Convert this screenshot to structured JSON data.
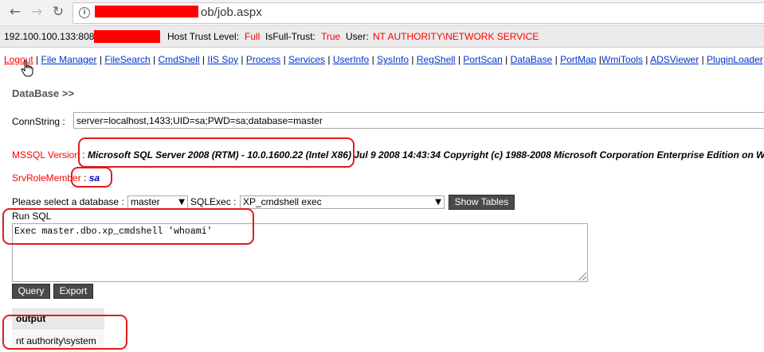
{
  "browser": {
    "back_icon": "back-arrow-icon",
    "forward_icon": "forward-arrow-icon",
    "reload_icon": "reload-icon",
    "info_icon": "i",
    "url_suffix": "ob/job.aspx"
  },
  "info_bar": {
    "ip": "192.100.100.133:808",
    "host_trust_label": "Host Trust Level:",
    "host_trust_value": "Full",
    "full_trust_label": "IsFull-Trust:",
    "full_trust_value": "True",
    "user_label": "User:",
    "user_value": "NT AUTHORITY\\NETWORK SERVICE"
  },
  "menu": {
    "items": [
      "Logout",
      "File Manager",
      "FileSearch",
      "CmdShell",
      "IIS Spy",
      "Process",
      "Services",
      "UserInfo",
      "SysInfo",
      "RegShell",
      "PortScan",
      "DataBase",
      "PortMap",
      "WmiTools",
      "ADSViewer",
      "PluginLoader"
    ],
    "separator": "|"
  },
  "main": {
    "title": "DataBase >>",
    "conn_label": "ConnString :",
    "conn_value": "server=localhost,1433;UID=sa;PWD=sa;database=master",
    "version_label": "MSSQL Version",
    "version_sep": " : ",
    "version_value": "Microsoft SQL Server 2008 (RTM) - 10.0.1600.22 (Intel X86)",
    "version_rest": " Jul 9 2008 14:43:34 Copyright (c) 1988-2008 Microsoft Corporation Enterprise Edition on W",
    "srvrole_label": "SrvRoleMember",
    "srvrole_sep": " : ",
    "srvrole_value": "sa",
    "db_select_label": "Please select a database :",
    "db_selected": "master",
    "sqlexec_label": "SQLExec :",
    "sqlexec_selected": "XP_cmdshell exec",
    "show_tables": "Show Tables",
    "run_sql_label": "Run SQL",
    "sql_text": "Exec master.dbo.xp_cmdshell 'whoami'",
    "query_button": "Query",
    "export_button": "Export",
    "output_header": "output",
    "output_value": "nt authority\\system"
  },
  "colors": {
    "annotation": "#e21b1b",
    "link": "#0033cc",
    "redaction": "#ff0000"
  }
}
